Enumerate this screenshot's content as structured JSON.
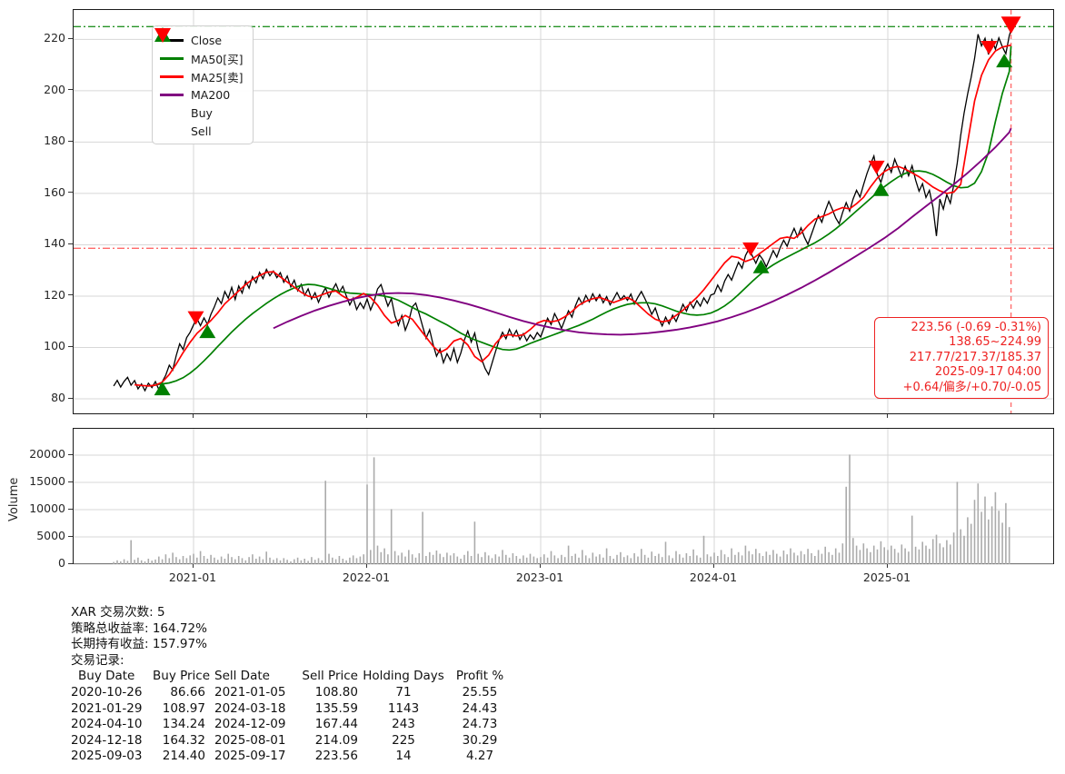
{
  "page": {
    "background": "#ffffff"
  },
  "legend": {
    "items": [
      {
        "label": "Close",
        "color": "#000000",
        "marker": "line"
      },
      {
        "label": "MA50[买]",
        "color": "#008000",
        "marker": "line"
      },
      {
        "label": "MA25[卖]",
        "color": "#ff0000",
        "marker": "line"
      },
      {
        "label": "MA200",
        "color": "#800080",
        "marker": "line"
      },
      {
        "label": "Buy",
        "color": "#008000",
        "marker": "triangle-up"
      },
      {
        "label": "Sell",
        "color": "#ff0000",
        "marker": "triangle-down"
      }
    ]
  },
  "chart_data": {
    "type": "line",
    "title": "",
    "x_axis": {
      "tick_years": [
        2021,
        2022,
        2023,
        2024,
        2025
      ],
      "tick_labels": [
        "2021-01",
        "2022-01",
        "2023-01",
        "2024-01",
        "2025-01"
      ],
      "t_start": 2020.54,
      "t_end": 2025.71
    },
    "price_panel": {
      "ylim": [
        73,
        231
      ],
      "yticks": [
        80,
        100,
        120,
        140,
        160,
        180,
        200,
        220
      ],
      "grid": true,
      "series": {
        "close": {
          "name": "Close",
          "color": "#000000",
          "width": 1.3,
          "t0": 2020.54,
          "dt": 0.02,
          "last_point": [
            2025.71,
            223.56
          ],
          "values": [
            85.0,
            87.2,
            84.6,
            86.8,
            88.4,
            85.3,
            87.1,
            83.9,
            85.8,
            83.2,
            86.1,
            84.4,
            86.7,
            83.6,
            86.7,
            89.2,
            93.1,
            91.2,
            96.8,
            101.4,
            99.2,
            103.8,
            105.9,
            108.8,
            111.2,
            108.5,
            111.5,
            109.0,
            112.9,
            115.8,
            119.3,
            117.1,
            121.8,
            119.2,
            123.4,
            118.7,
            123.9,
            121.2,
            125.8,
            123.1,
            127.6,
            125.2,
            129.3,
            126.8,
            130.4,
            127.9,
            129.8,
            127.2,
            129.1,
            125.4,
            127.8,
            123.6,
            126.2,
            122.1,
            124.6,
            120.3,
            122.8,
            118.9,
            121.3,
            117.6,
            120.7,
            123.2,
            119.6,
            122.4,
            124.8,
            121.5,
            123.8,
            120.1,
            116.6,
            119.2,
            114.8,
            117.4,
            115.2,
            118.9,
            114.6,
            117.9,
            122.8,
            124.5,
            120.2,
            116.1,
            119.0,
            112.3,
            108.6,
            112.4,
            106.7,
            110.2,
            115.8,
            117.3,
            113.1,
            108.2,
            103.6,
            106.9,
            101.2,
            96.6,
            99.4,
            94.1,
            97.6,
            95.0,
            99.6,
            94.2,
            97.8,
            102.9,
            106.4,
            102.1,
            105.6,
            99.2,
            95.4,
            91.8,
            89.4,
            93.9,
            98.4,
            102.8,
            105.9,
            103.4,
            107.1,
            104.2,
            106.6,
            103.1,
            105.4,
            102.6,
            104.9,
            103.2,
            105.8,
            104.1,
            107.8,
            111.4,
            108.9,
            113.2,
            110.6,
            107.4,
            110.9,
            114.3,
            111.8,
            116.2,
            119.4,
            116.9,
            120.3,
            117.8,
            120.9,
            118.2,
            120.6,
            117.4,
            119.8,
            116.6,
            118.9,
            121.4,
            118.6,
            120.2,
            118.4,
            120.8,
            116.9,
            119.6,
            121.8,
            119.1,
            116.2,
            112.9,
            115.4,
            111.2,
            108.4,
            111.8,
            109.2,
            112.6,
            110.1,
            113.4,
            116.8,
            114.2,
            117.6,
            115.3,
            118.2,
            116.1,
            119.3,
            117.2,
            120.4,
            120.9,
            124.3,
            121.8,
            125.9,
            128.4,
            126.2,
            129.8,
            133.2,
            130.9,
            135.8,
            138.4,
            135.6,
            132.8,
            136.1,
            134.2,
            131.4,
            134.6,
            137.8,
            135.2,
            138.9,
            141.8,
            139.4,
            143.2,
            146.4,
            143.1,
            146.6,
            142.9,
            140.2,
            144.1,
            147.9,
            151.4,
            148.8,
            153.2,
            156.9,
            153.8,
            150.4,
            148.2,
            152.6,
            156.4,
            153.1,
            157.8,
            161.2,
            158.6,
            163.4,
            167.8,
            171.4,
            174.6,
            167.4,
            164.3,
            168.9,
            171.5,
            168.2,
            173.4,
            169.8,
            166.4,
            170.6,
            166.9,
            170.8,
            165.2,
            160.9,
            163.8,
            158.4,
            161.2,
            154.6,
            143.4,
            157.8,
            153.9,
            159.6,
            156.2,
            163.4,
            171.8,
            182.6,
            191.4,
            198.8,
            205.2,
            212.6,
            222.0,
            217.5,
            220.4,
            214.1,
            219.8,
            216.2,
            220.6,
            217.1,
            214.4,
            221.5
          ]
        },
        "ma25": {
          "name": "MA25[卖]",
          "color": "#ff0000",
          "width": 1.7,
          "t0": 2020.66,
          "dt": 0.04,
          "last_point": [
            2025.71,
            217.77
          ],
          "values": [
            85.5,
            85.2,
            85.0,
            85.3,
            86.5,
            89.5,
            93.5,
            98.0,
            102.0,
            105.5,
            108.0,
            110.5,
            113.5,
            117.0,
            119.5,
            122.0,
            124.5,
            126.5,
            128.0,
            129.3,
            129.5,
            127.5,
            125.5,
            123.5,
            121.5,
            120.0,
            119.5,
            120.5,
            121.5,
            122.0,
            120.0,
            118.5,
            119.5,
            121.0,
            119.5,
            116.5,
            112.5,
            109.5,
            110.5,
            112.5,
            111.0,
            107.5,
            104.0,
            100.5,
            98.0,
            99.5,
            102.5,
            103.5,
            101.0,
            96.5,
            94.5,
            97.0,
            101.5,
            104.5,
            105.0,
            104.5,
            105.0,
            107.0,
            109.5,
            110.5,
            110.0,
            110.5,
            112.0,
            114.0,
            116.5,
            118.0,
            119.0,
            119.5,
            118.5,
            117.5,
            118.5,
            119.5,
            118.0,
            115.5,
            113.0,
            111.0,
            110.0,
            110.5,
            112.5,
            114.5,
            117.0,
            119.5,
            122.5,
            126.0,
            129.5,
            133.0,
            135.5,
            135.0,
            133.5,
            134.5,
            136.5,
            138.5,
            140.5,
            142.5,
            143.0,
            142.5,
            144.5,
            147.5,
            150.0,
            151.0,
            152.0,
            153.5,
            154.5,
            154.0,
            156.0,
            158.5,
            162.5,
            166.0,
            168.5,
            170.0,
            170.5,
            169.5,
            168.0,
            166.5,
            164.5,
            162.5,
            161.0,
            160.0,
            160.5,
            163.5,
            180.0,
            196.0,
            206.0,
            212.0,
            215.5,
            217.0
          ]
        },
        "ma50": {
          "name": "MA50[买]",
          "color": "#008000",
          "width": 1.7,
          "t0": 2020.78,
          "dt": 0.04,
          "last_point": [
            2025.71,
            217.37
          ],
          "values": [
            85.5,
            85.8,
            86.2,
            87.0,
            88.2,
            90.0,
            92.2,
            94.8,
            97.5,
            100.4,
            103.2,
            106.0,
            108.6,
            111.0,
            113.2,
            115.2,
            117.2,
            119.0,
            120.6,
            122.0,
            123.2,
            124.2,
            124.6,
            124.4,
            123.8,
            123.0,
            122.2,
            121.6,
            121.2,
            121.0,
            120.8,
            120.6,
            120.4,
            120.0,
            119.4,
            118.4,
            117.0,
            115.6,
            114.2,
            113.0,
            111.6,
            110.2,
            108.8,
            107.2,
            105.6,
            104.2,
            103.0,
            102.0,
            101.0,
            100.0,
            99.2,
            99.0,
            99.4,
            100.4,
            101.6,
            102.6,
            103.6,
            104.6,
            105.6,
            106.6,
            107.6,
            108.6,
            109.8,
            111.0,
            112.4,
            113.8,
            115.0,
            116.0,
            116.8,
            117.2,
            117.4,
            117.4,
            117.0,
            116.2,
            115.2,
            114.2,
            113.4,
            112.8,
            112.6,
            112.8,
            113.4,
            114.6,
            116.2,
            118.2,
            120.6,
            123.2,
            125.8,
            128.2,
            130.4,
            132.2,
            133.8,
            135.2,
            136.6,
            138.0,
            139.4,
            140.8,
            142.4,
            144.2,
            146.2,
            148.4,
            150.8,
            153.2,
            155.6,
            158.0,
            160.4,
            162.6,
            164.6,
            166.4,
            167.8,
            168.6,
            168.8,
            168.4,
            167.4,
            166.0,
            164.4,
            163.0,
            162.2,
            162.4,
            164.0,
            168.5,
            176.0,
            188.0,
            199.0,
            207.5
          ]
        },
        "ma200": {
          "name": "MA200",
          "color": "#800080",
          "width": 1.9,
          "t0": 2021.46,
          "dt": 0.08,
          "last_point": [
            2025.71,
            185.37
          ],
          "values": [
            107.5,
            110.0,
            112.3,
            114.4,
            116.2,
            117.8,
            119.2,
            120.3,
            121.0,
            121.2,
            121.0,
            120.4,
            119.5,
            118.3,
            116.9,
            115.3,
            113.6,
            111.9,
            110.3,
            108.9,
            107.7,
            106.7,
            105.9,
            105.4,
            105.1,
            105.0,
            105.2,
            105.6,
            106.2,
            106.9,
            107.8,
            108.9,
            110.2,
            111.8,
            113.6,
            115.7,
            118.0,
            120.5,
            123.2,
            126.1,
            129.2,
            132.4,
            135.7,
            139.1,
            142.6,
            146.5,
            150.8,
            155.0,
            159.2,
            163.5,
            168.0,
            172.8,
            178.0,
            183.8
          ]
        }
      },
      "buy_signals": [
        {
          "date": "2020-10-26",
          "t": 2020.82,
          "price": 86.66
        },
        {
          "date": "2021-01-29",
          "t": 2021.08,
          "price": 108.97
        },
        {
          "date": "2024-04-10",
          "t": 2024.27,
          "price": 134.24
        },
        {
          "date": "2024-12-18",
          "t": 2024.96,
          "price": 164.32
        },
        {
          "date": "2025-09-03",
          "t": 2025.671,
          "price": 214.4
        }
      ],
      "sell_signals": [
        {
          "date": "2021-01-05",
          "t": 2021.013,
          "price": 108.8
        },
        {
          "date": "2024-03-18",
          "t": 2024.21,
          "price": 135.59
        },
        {
          "date": "2024-12-09",
          "t": 2024.935,
          "price": 167.44
        },
        {
          "date": "2025-08-01",
          "t": 2025.583,
          "price": 214.09
        },
        {
          "date": "2025-09-17",
          "t": 2025.71,
          "price": 223.56
        }
      ],
      "hlines": [
        {
          "price": 224.99,
          "color": "#008000",
          "style": "dashdot",
          "opacity": 0.85
        },
        {
          "price": 138.65,
          "color": "#ff4444",
          "style": "dashdot",
          "opacity": 0.8
        }
      ],
      "vline": {
        "t": 2025.71,
        "color": "#ff5555",
        "style": "dashed",
        "opacity": 0.85
      }
    },
    "volume_panel": {
      "ylabel": "Volume",
      "yticks": [
        0,
        5000,
        10000,
        15000,
        20000
      ],
      "bar_color": "#ababab",
      "t0": 2020.54,
      "dt": 0.02,
      "values": [
        400,
        700,
        500,
        900,
        600,
        4400,
        800,
        1200,
        700,
        500,
        1000,
        650,
        850,
        1400,
        900,
        1800,
        1100,
        2100,
        1300,
        900,
        1500,
        1100,
        1600,
        1900,
        1200,
        2400,
        1500,
        1000,
        1700,
        1200,
        800,
        1400,
        1000,
        1900,
        1300,
        900,
        1500,
        1100,
        700,
        1300,
        1800,
        1000,
        1400,
        900,
        2300,
        1200,
        800,
        1100,
        700,
        1100,
        800,
        500,
        900,
        1200,
        700,
        1000,
        600,
        1300,
        800,
        1100,
        700,
        15300,
        1900,
        1200,
        900,
        1500,
        1000,
        700,
        1200,
        1600,
        1100,
        1400,
        1800,
        14600,
        2600,
        19600,
        3400,
        2200,
        2900,
        1800,
        10100,
        2400,
        1600,
        2100,
        1400,
        2600,
        1800,
        1200,
        2000,
        9600,
        1500,
        2200,
        1700,
        2500,
        1900,
        1300,
        2100,
        1600,
        2000,
        1400,
        1000,
        1700,
        2400,
        1500,
        7800,
        1900,
        1300,
        2200,
        1600,
        1100,
        1800,
        1400,
        2600,
        1700,
        1200,
        2000,
        1500,
        1000,
        1600,
        1200,
        1900,
        1400,
        1100,
        1300,
        1800,
        1200,
        2400,
        1600,
        1100,
        1700,
        1300,
        3400,
        1500,
        1900,
        1200,
        2600,
        1600,
        1100,
        2100,
        1400,
        1800,
        1200,
        2900,
        1500,
        1000,
        1700,
        2200,
        1300,
        1600,
        1100,
        2000,
        1400,
        2800,
        1700,
        1200,
        2300,
        1500,
        1900,
        1300,
        4100,
        1600,
        1100,
        2400,
        1800,
        1200,
        2000,
        1500,
        2700,
        1600,
        1200,
        5200,
        1800,
        1400,
        2100,
        1500,
        2600,
        1800,
        1300,
        2900,
        1700,
        2200,
        1600,
        3400,
        2400,
        1800,
        2800,
        2000,
        1500,
        2300,
        1700,
        2600,
        1900,
        1400,
        2500,
        1800,
        2900,
        2100,
        1600,
        2400,
        1800,
        2800,
        2000,
        1500,
        2600,
        1900,
        3200,
        2200,
        1700,
        2900,
        2100,
        3800,
        14200,
        20100,
        4800,
        3400,
        2600,
        3800,
        2900,
        2200,
        3400,
        2700,
        4200,
        3100,
        2600,
        3400,
        2800,
        2100,
        3600,
        2900,
        2300,
        8900,
        3200,
        2700,
        4100,
        3400,
        2800,
        4600,
        5400,
        3800,
        3100,
        4400,
        3600,
        5800,
        15100,
        6400,
        5200,
        8600,
        7400,
        11800,
        14800,
        9600,
        12400,
        8200,
        10600,
        13200,
        9800,
        7600,
        11200,
        6800
      ]
    },
    "annotation": {
      "color": "#ee2222",
      "lines": [
        "223.56 (-0.69 -0.31%)",
        "138.65~224.99",
        "217.77/217.37/185.37",
        "2025-09-17 04:00",
        "+0.64/偏多/+0.70/-0.05"
      ]
    }
  },
  "stats": {
    "lines": [
      "XAR 交易次数: 5",
      "策略总收益率: 164.72%",
      "长期持有收益: 157.97%",
      "交易记录:"
    ]
  },
  "trades": {
    "headers": [
      "Buy Date",
      "Buy Price",
      "Sell Date",
      "Sell Price",
      "Holding Days",
      "Profit %"
    ],
    "rows": [
      [
        "2020-10-26",
        "86.66",
        "2021-01-05",
        "108.80",
        "71",
        "25.55"
      ],
      [
        "2021-01-29",
        "108.97",
        "2024-03-18",
        "135.59",
        "1143",
        "24.43"
      ],
      [
        "2024-04-10",
        "134.24",
        "2024-12-09",
        "167.44",
        "243",
        "24.73"
      ],
      [
        "2024-12-18",
        "164.32",
        "2025-08-01",
        "214.09",
        "225",
        "30.29"
      ],
      [
        "2025-09-03",
        "214.40",
        "2025-09-17",
        "223.56",
        "14",
        "4.27"
      ]
    ]
  }
}
